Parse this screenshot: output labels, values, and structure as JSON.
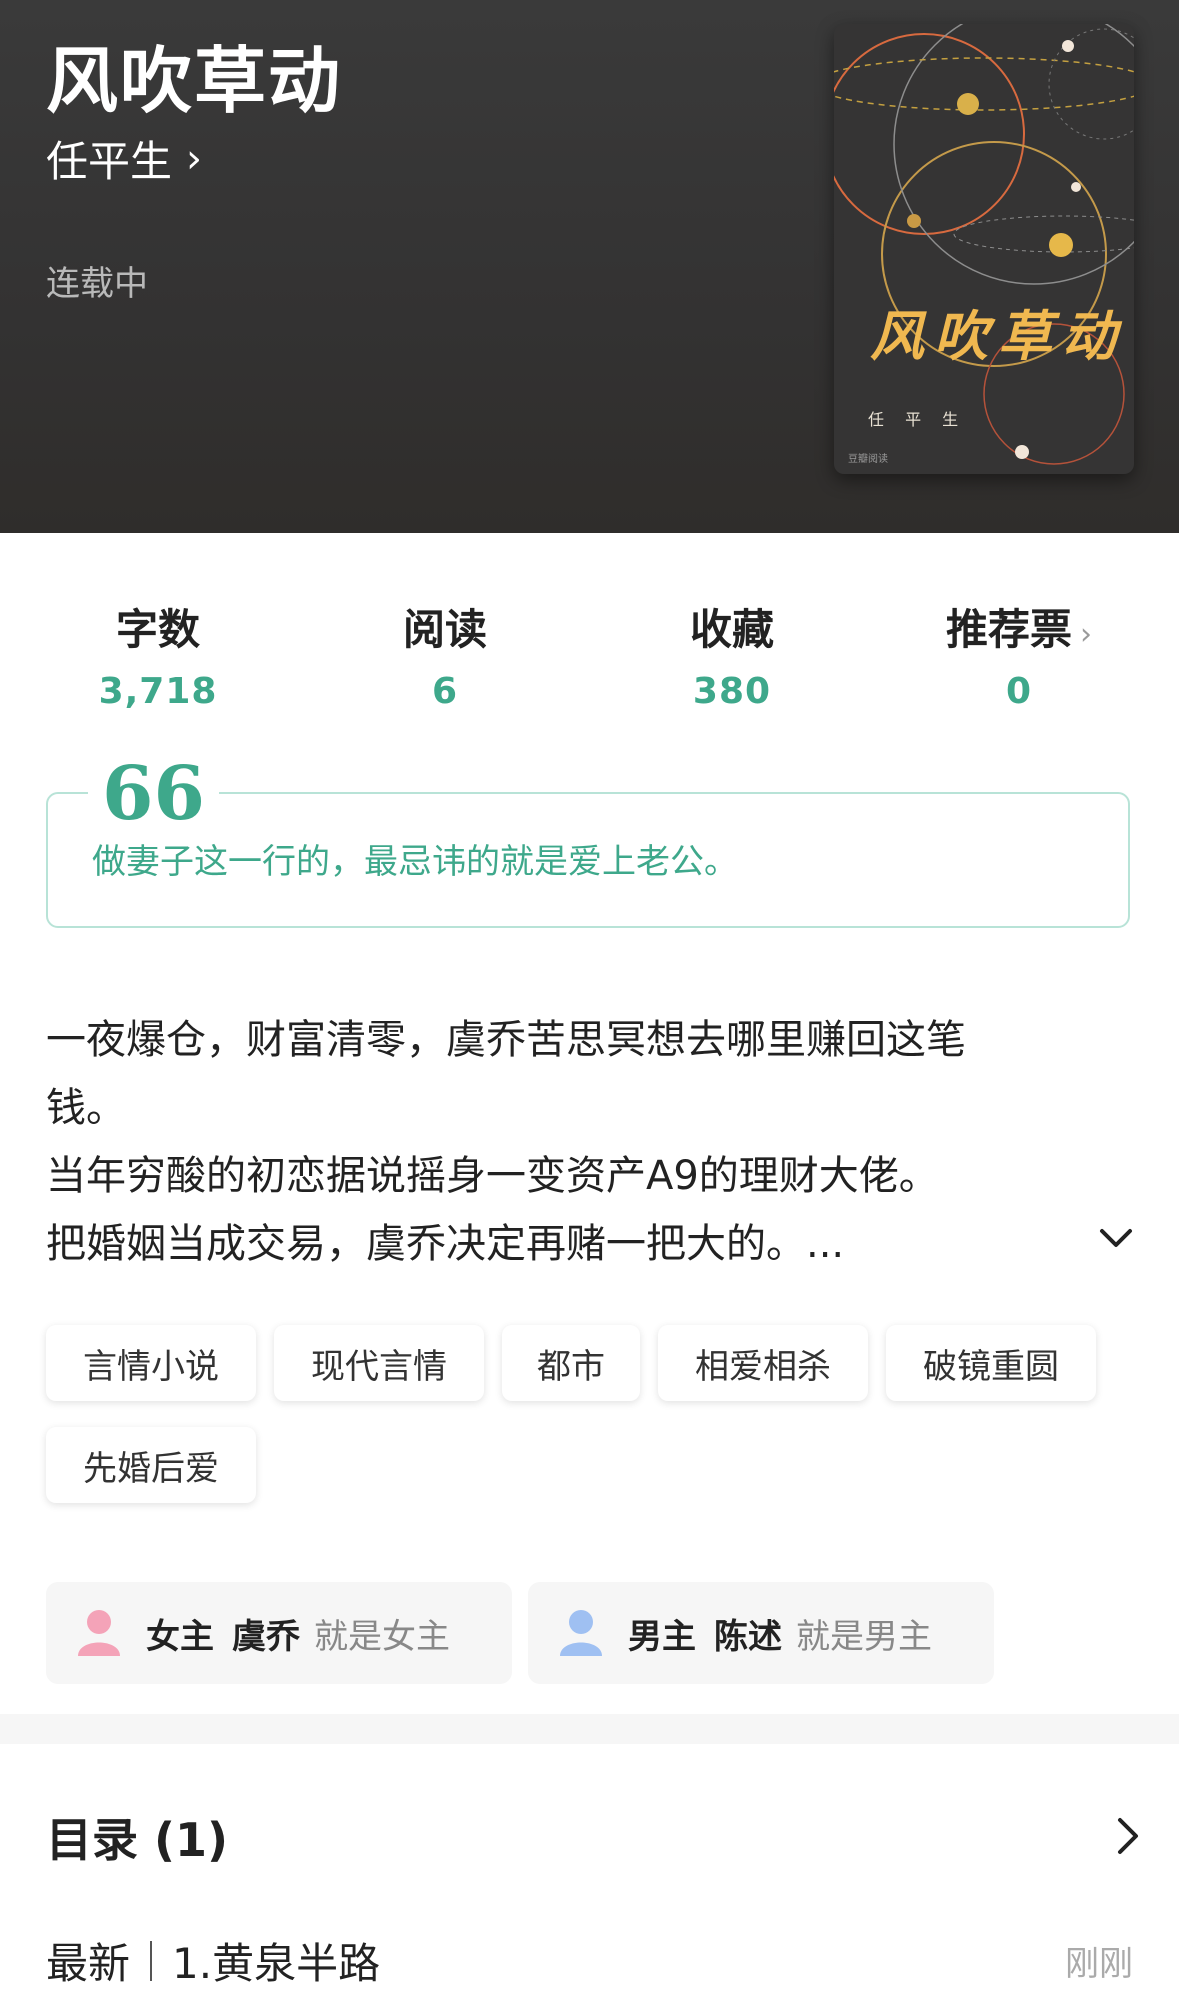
{
  "book": {
    "title": "风吹草动",
    "author": "任平生",
    "status": "连载中"
  },
  "cover": {
    "title": "风吹草动",
    "author": "任 平 生",
    "brand": "豆瓣阅读"
  },
  "stats": [
    {
      "label": "字数",
      "value": "3,718"
    },
    {
      "label": "阅读",
      "value": "6"
    },
    {
      "label": "收藏",
      "value": "380"
    },
    {
      "label": "推荐票",
      "value": "0"
    }
  ],
  "quote": {
    "mark": "66",
    "text": "做妻子这一行的，最忌讳的就是爱上老公。"
  },
  "synopsis": {
    "lines": [
      "一夜爆仓，财富清零，虞乔苦思冥想去哪里赚回这笔",
      "钱。",
      "当年穷酸的初恋据说摇身一变资产A9的理财大佬。",
      "把婚姻当成交易，虞乔决定再赌一把大的。..."
    ]
  },
  "tags": [
    "言情小说",
    "现代言情",
    "都市",
    "相爱相杀",
    "破镜重圆",
    "先婚后爱"
  ],
  "characters": [
    {
      "role": "女主",
      "name": "虞乔",
      "desc": "就是女主",
      "color": "#f4a3b8"
    },
    {
      "role": "男主",
      "name": "陈述",
      "desc": "就是男主",
      "color": "#9fc0f2"
    }
  ],
  "toc": {
    "title": "目录 (1)",
    "latest_label": "最新",
    "latest_chapter": "1.黄泉半路",
    "latest_time": "刚刚"
  },
  "colors": {
    "accent": "#3ea88b",
    "header_bg": "#363535"
  }
}
